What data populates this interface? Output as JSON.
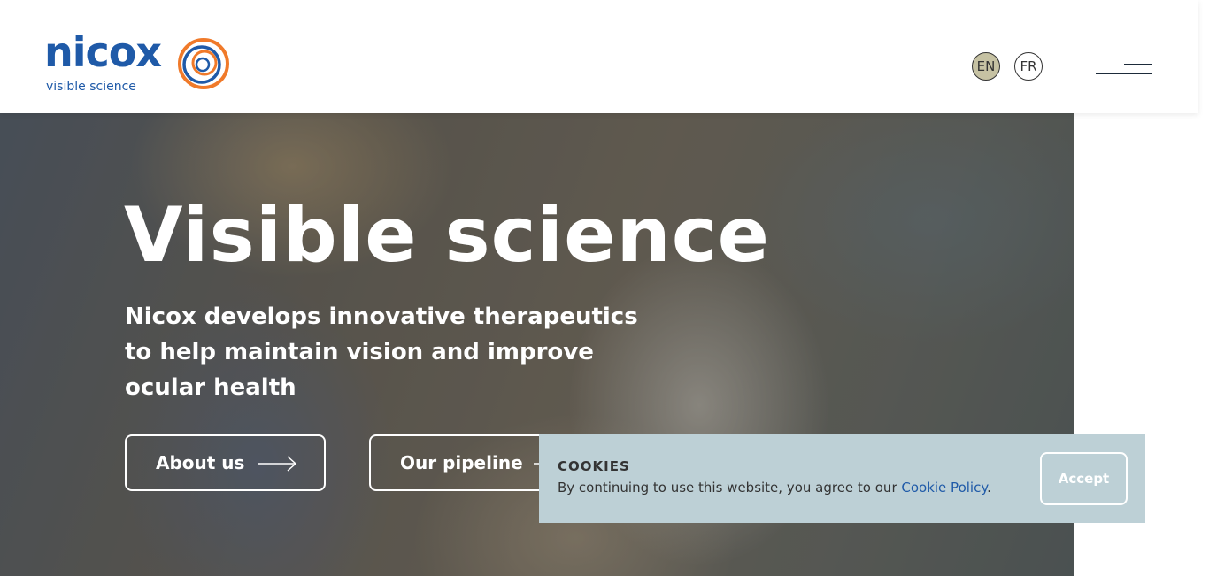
{
  "header": {
    "logo_word": "nicox",
    "logo_tagline": "visible science",
    "languages": [
      "EN",
      "FR"
    ],
    "active_language": "EN"
  },
  "hero": {
    "title": "Visible science",
    "subtitle": "Nicox develops innovative therapeutics to help maintain vision and improve ocular health",
    "buttons": [
      {
        "label": "About us",
        "icon": "arrow-right-icon"
      },
      {
        "label": "Our pipeline",
        "icon": "arrow-right-icon"
      }
    ]
  },
  "cookie_banner": {
    "title": "COOKIES",
    "text_prefix": "By continuing to use this website, you agree to our ",
    "link_text": "Cookie Policy",
    "text_suffix": ".",
    "accept_label": "Accept"
  },
  "colors": {
    "brand_blue": "#1f5aa8",
    "brand_orange": "#f07a2a",
    "active_lang_bg": "#c6c2a3",
    "cookie_bg": "#bdd0d6"
  }
}
